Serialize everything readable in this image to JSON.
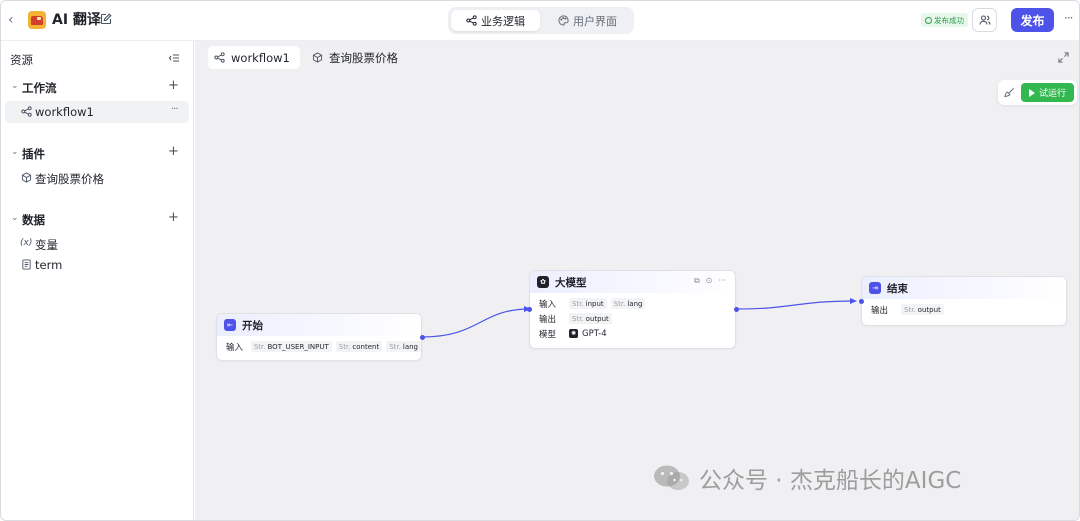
{
  "header": {
    "app_title": "AI 翻译",
    "tabs": [
      {
        "label": "业务逻辑",
        "icon": "flow-icon",
        "active": true
      },
      {
        "label": "用户界面",
        "icon": "palette-icon",
        "active": false
      }
    ],
    "status_badge": "发布成功",
    "publish_label": "发布",
    "colors": {
      "accent": "#4d53e8",
      "success": "#26a148"
    }
  },
  "sidebar": {
    "title": "资源",
    "sections": [
      {
        "label": "工作流",
        "items": [
          {
            "label": "workflow1",
            "icon": "workflow-icon",
            "selected": true
          }
        ]
      },
      {
        "label": "插件",
        "items": [
          {
            "label": "查询股票价格",
            "icon": "cube-icon"
          }
        ]
      },
      {
        "label": "数据",
        "items": [
          {
            "label": "变量",
            "icon": "variable-icon",
            "glyph": "(x)"
          },
          {
            "label": "term",
            "icon": "document-icon"
          }
        ]
      }
    ]
  },
  "canvas": {
    "tabs": [
      {
        "label": "workflow1",
        "icon": "workflow-icon",
        "active": true
      },
      {
        "label": "查询股票价格",
        "icon": "cube-icon",
        "active": false
      }
    ],
    "run_label": "试运行",
    "nodes": {
      "start": {
        "title": "开始",
        "input_label": "输入",
        "inputs": [
          {
            "type": "Str.",
            "name": "BOT_USER_INPUT"
          },
          {
            "type": "Str.",
            "name": "content"
          },
          {
            "type": "Str.",
            "name": "lang"
          }
        ]
      },
      "llm": {
        "title": "大模型",
        "input_label": "输入",
        "inputs": [
          {
            "type": "Str.",
            "name": "input"
          },
          {
            "type": "Str.",
            "name": "lang"
          }
        ],
        "output_label": "输出",
        "outputs": [
          {
            "type": "Str.",
            "name": "output"
          }
        ],
        "model_label": "模型",
        "model": "GPT-4"
      },
      "end": {
        "title": "结束",
        "output_label": "输出",
        "outputs": [
          {
            "type": "Str.",
            "name": "output"
          }
        ]
      }
    }
  },
  "watermark": "公众号 · 杰克船长的AIGC"
}
